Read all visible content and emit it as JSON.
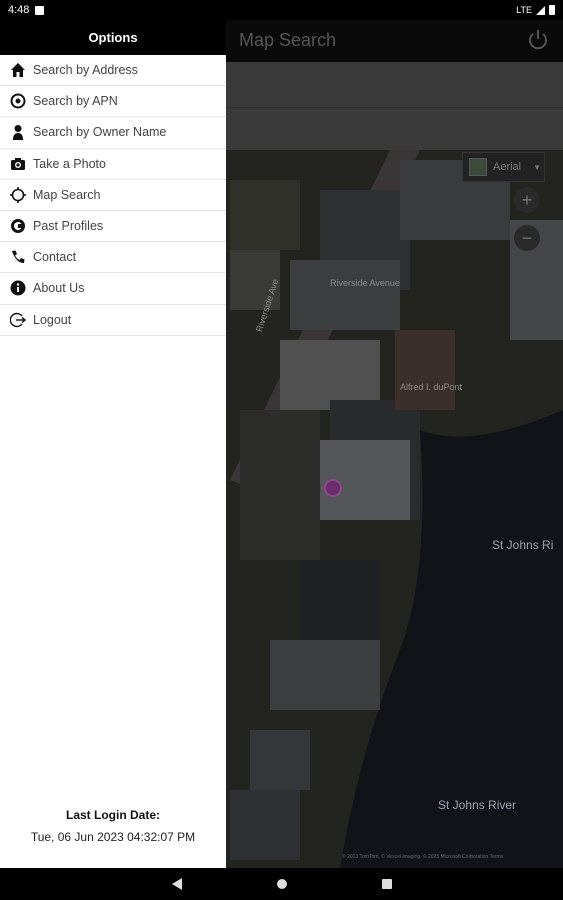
{
  "status": {
    "time": "4:48",
    "network": "LTE"
  },
  "app_bar": {
    "title": "Map Search"
  },
  "drawer": {
    "header": "Options",
    "items": [
      {
        "label": "Search by Address",
        "icon": "home-icon"
      },
      {
        "label": "Search by APN",
        "icon": "gear-icon"
      },
      {
        "label": "Search by Owner Name",
        "icon": "person-icon"
      },
      {
        "label": "Take a Photo",
        "icon": "camera-icon"
      },
      {
        "label": "Map Search",
        "icon": "crosshair-icon"
      },
      {
        "label": "Past Profiles",
        "icon": "history-icon"
      },
      {
        "label": "Contact",
        "icon": "phone-icon"
      },
      {
        "label": "About Us",
        "icon": "info-icon"
      },
      {
        "label": "Logout",
        "icon": "logout-icon"
      }
    ],
    "login_title": "Last Login Date:",
    "login_date": "Tue, 06 Jun 2023 04:32:07 PM"
  },
  "map": {
    "layer_label": "Aerial",
    "zoom_in": "+",
    "zoom_out": "−",
    "labels": {
      "river1": "St Johns Ri",
      "river2": "St Johns River",
      "street1": "Riverside Ave",
      "street2": "Riverside Avenue",
      "building1": "Alfred I. duPont",
      "building2": "Riverside Avenue"
    },
    "copyright": "© 2023 TomTom, © Vexcel Imaging, © 2023 Microsoft Corporation  Terms"
  }
}
